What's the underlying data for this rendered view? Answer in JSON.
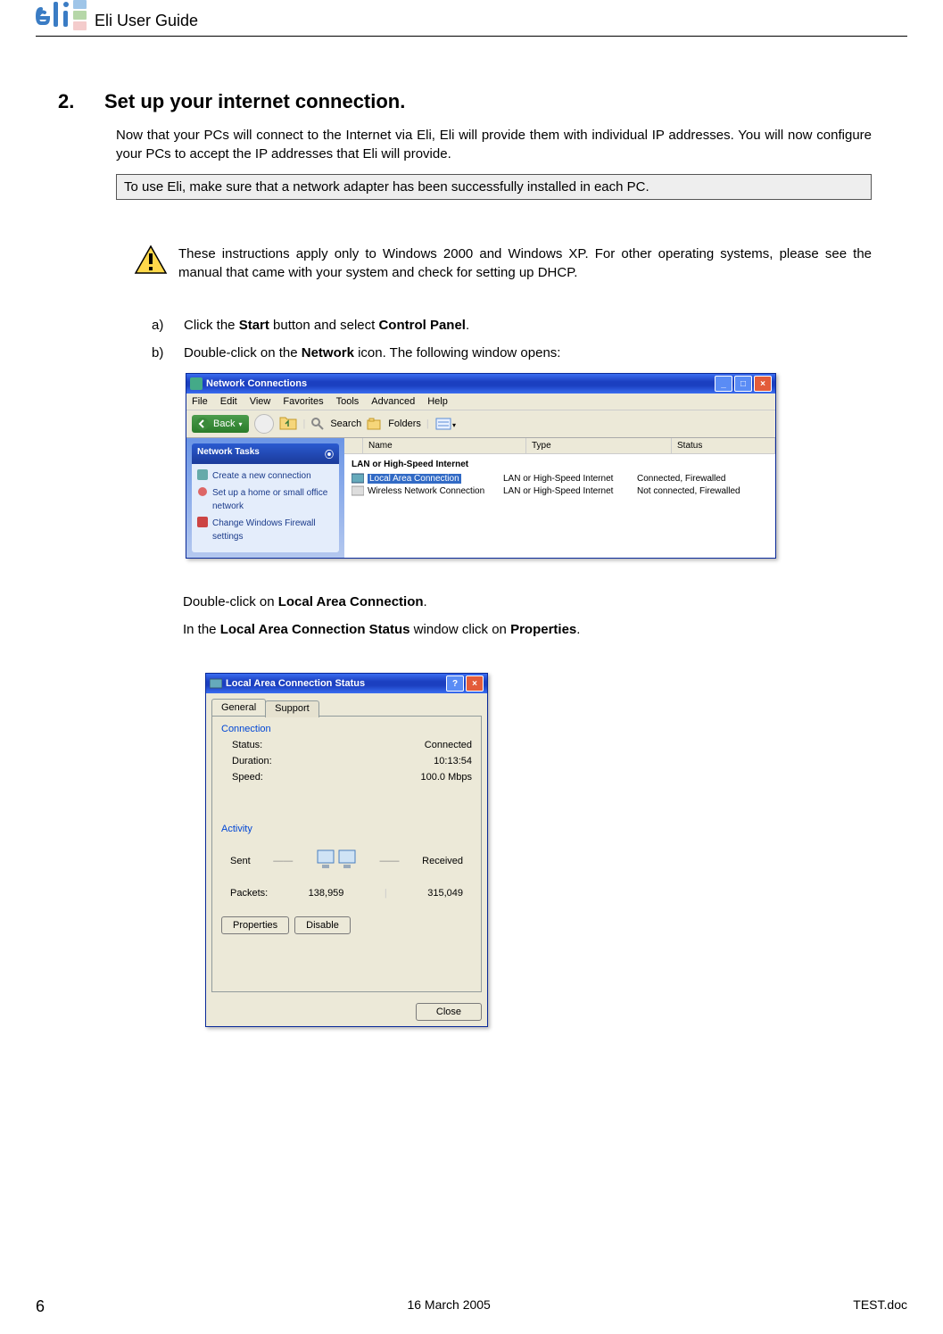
{
  "header": {
    "doc_title": "Eli User Guide"
  },
  "section": {
    "number": "2.",
    "title": "Set up your internet connection."
  },
  "intro": "Now that your PCs will connect to the Internet via Eli, Eli will provide them with individual IP addresses. You will now configure your PCs to accept the IP addresses that Eli will provide.",
  "note": "To use Eli, make sure that a network adapter has been successfully installed in each PC.",
  "warning": "These instructions apply only to Windows 2000 and Windows XP. For other operating systems, please see the manual that came with your system and check for setting up DHCP.",
  "steps": {
    "a": {
      "letter": "a)",
      "pre": "Click the ",
      "b1": "Start",
      "mid": " button and select ",
      "b2": "Control Panel",
      "post": "."
    },
    "b": {
      "letter": "b)",
      "pre": "Double-click on the ",
      "b1": "Network",
      "post": " icon. The following window opens:"
    }
  },
  "post1": {
    "pre": "Double-click on ",
    "b1": "Local Area Connection",
    "post": "."
  },
  "post2": {
    "pre": "In the ",
    "b1": "Local Area Connection Status",
    "mid": " window click on ",
    "b2": "Properties",
    "post": "."
  },
  "win1": {
    "title": "Network Connections",
    "menu": [
      "File",
      "Edit",
      "View",
      "Favorites",
      "Tools",
      "Advanced",
      "Help"
    ],
    "back": "Back",
    "search": "Search",
    "folders": "Folders",
    "sidepane": {
      "header": "Network Tasks",
      "items": [
        "Create a new connection",
        "Set up a home or small office network",
        "Change Windows Firewall settings"
      ]
    },
    "columns": {
      "name": "Name",
      "type": "Type",
      "status": "Status"
    },
    "group": "LAN or High-Speed Internet",
    "rows": [
      {
        "name": "Local Area Connection",
        "type": "LAN or High-Speed Internet",
        "status": "Connected, Firewalled",
        "selected": true
      },
      {
        "name": "Wireless Network Connection",
        "type": "LAN or High-Speed Internet",
        "status": "Not connected, Firewalled",
        "selected": false
      }
    ]
  },
  "win2": {
    "title": "Local Area Connection Status",
    "tabs": [
      "General",
      "Support"
    ],
    "connection_label": "Connection",
    "status_label": "Status:",
    "status_value": "Connected",
    "duration_label": "Duration:",
    "duration_value": "10:13:54",
    "speed_label": "Speed:",
    "speed_value": "100.0 Mbps",
    "activity_label": "Activity",
    "sent_label": "Sent",
    "received_label": "Received",
    "packets_label": "Packets:",
    "packets_sent": "138,959",
    "packets_received": "315,049",
    "properties_btn": "Properties",
    "disable_btn": "Disable",
    "close_btn": "Close"
  },
  "footer": {
    "page": "6",
    "date": "16 March 2005",
    "file": "TEST.doc"
  }
}
